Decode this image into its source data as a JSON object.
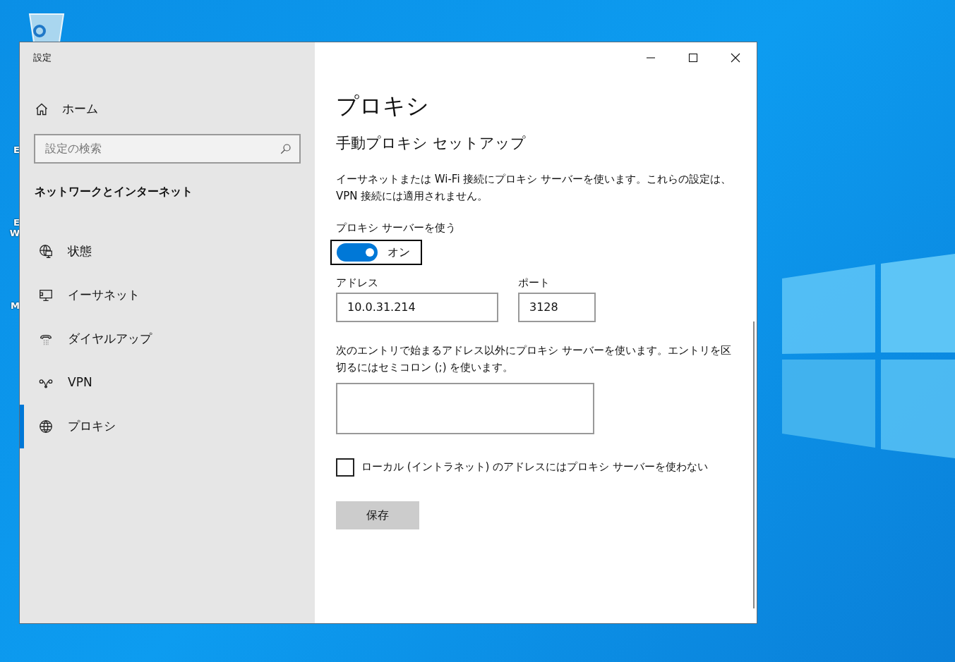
{
  "desktop": {
    "icon_label_fragments": [
      {
        "text": "E"
      },
      {
        "text": "E\nW"
      },
      {
        "text": "M"
      }
    ]
  },
  "window": {
    "title": "設定",
    "controls": [
      {
        "kind": "minimize"
      },
      {
        "kind": "maximize"
      },
      {
        "kind": "close"
      }
    ]
  },
  "sidebar": {
    "home": "ホーム",
    "search": {
      "placeholder": "設定の検索"
    },
    "section": "ネットワークとインターネット",
    "items": [
      {
        "label": "状態",
        "kind": "status",
        "selected": false
      },
      {
        "label": "イーサネット",
        "kind": "ethernet",
        "selected": false
      },
      {
        "label": "ダイヤルアップ",
        "kind": "dialup",
        "selected": false
      },
      {
        "label": "VPN",
        "kind": "vpn",
        "selected": false
      },
      {
        "label": "プロキシ",
        "kind": "proxy",
        "selected": true
      }
    ]
  },
  "content": {
    "title": "プロキシ",
    "subtitle": "手動プロキシ セットアップ",
    "description": "イーサネットまたは Wi-Fi 接続にプロキシ サーバーを使います。これらの設定は、VPN 接続には適用されません。",
    "toggle": {
      "label": "プロキシ サーバーを使う",
      "on": true,
      "state_text": "オン"
    },
    "address": {
      "label": "アドレス",
      "value": "10.0.31.214"
    },
    "port": {
      "label": "ポート",
      "value": "3128"
    },
    "exceptions": {
      "description": "次のエントリで始まるアドレス以外にプロキシ サーバーを使います。エントリを区切るにはセミコロン (;) を使います。"
    },
    "bypass_local": {
      "label": "ローカル (イントラネット) のアドレスにはプロキシ サーバーを使わない",
      "checked": false
    },
    "save_button": "保存"
  }
}
